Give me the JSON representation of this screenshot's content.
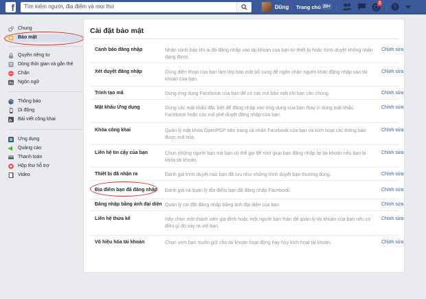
{
  "topbar": {
    "logo": "f",
    "search_placeholder": "Tìm kiếm người, địa điểm và mọi thứ",
    "user_name": "Dũng",
    "home_label": "Trang chủ",
    "home_badge": "20+",
    "notif_count": "3",
    "icons": [
      "search-icon",
      "friend-requests-icon",
      "messages-icon",
      "notifications-icon",
      "help-icon",
      "dropdown-icon"
    ]
  },
  "sidebar": {
    "items": [
      {
        "label": "Chung",
        "icon": "gear-icon",
        "color": "#8d949e"
      },
      {
        "label": "Bảo mật",
        "icon": "shield-icon",
        "color": "#f7b928",
        "active": true
      },
      {
        "label": "Quyền riêng tư",
        "icon": "lock-icon",
        "color": "#8d949e"
      },
      {
        "label": "Dòng thời gian và gắn thẻ",
        "icon": "timeline-icon",
        "color": "#8d949e"
      },
      {
        "label": "Chặn",
        "icon": "block-icon",
        "color": "#fa3e3e"
      },
      {
        "label": "Ngôn ngữ",
        "icon": "language-icon",
        "color": "#4b4f56"
      },
      {
        "label": "Thông báo",
        "icon": "globe-icon",
        "color": "#4b4f56"
      },
      {
        "label": "Di động",
        "icon": "mobile-icon",
        "color": "#4b4f56"
      },
      {
        "label": "Bài viết công khai",
        "icon": "rss-icon",
        "color": "#4b4f56"
      },
      {
        "label": "Ứng dụng",
        "icon": "apps-icon",
        "color": "#3b5998"
      },
      {
        "label": "Quảng cáo",
        "icon": "ads-icon",
        "color": "#42b72a"
      },
      {
        "label": "Thanh toán",
        "icon": "payment-icon",
        "color": "#4b4f56"
      },
      {
        "label": "Hộp thư hỗ trợ",
        "icon": "support-icon",
        "color": "#fa3e3e"
      },
      {
        "label": "Video",
        "icon": "video-icon",
        "color": "#4b4f56"
      }
    ]
  },
  "main": {
    "title": "Cài đặt bảo mật",
    "edit_label": "Chỉnh sửa",
    "rows": [
      {
        "label": "Cảnh báo đăng nhập",
        "desc": "Nhận cảnh báo khi ai đó đăng nhập vào tài khoản của bạn từ thiết bị hoặc trình duyệt không nhận dạng được."
      },
      {
        "label": "Xét duyệt đăng nhập",
        "desc": "Dùng điện thoại của bạn làm lớp bảo mật bổ sung để ngăn chặn người khác đăng nhập vào tài khoản của bạn."
      },
      {
        "label": "Trình tạo mã",
        "desc": "Dùng ứng dụng Facebook của bạn để có các mã bảo mật khi bạn cần chúng."
      },
      {
        "label": "Mật khẩu Ứng dụng",
        "desc": "Dùng các mật khẩu đặc biệt để đăng nhập vào ứng dụng của bạn thay vì dùng mật khẩu Facebook hoặc các mã phê duyệt đăng nhập của bạn."
      },
      {
        "label": "Khóa công khai",
        "desc": "Quản lý mật khóa OpenPGP trên trang cá nhân Facebook của bạn và kích hoạt các thông báo được mã hóa."
      },
      {
        "label": "Liên hệ tin cậy của bạn",
        "desc": "Chọn những người bạn mà bạn có thể gọi để nhờ giúp bạn đăng nhập lại tài khoản nếu bạn bị khóa tài khoản."
      },
      {
        "label": "Thiết bị đã nhận ra",
        "desc": "Đánh giá trình duyệt nào bạn đã lưu như những trình duyệt bạn thường dùng."
      },
      {
        "label": "Địa điểm bạn đã đăng nhập",
        "desc": "Đánh giá và quản lý địa điểm bạn đã đăng nhập Facebook."
      },
      {
        "label": "Đăng nhập bằng ảnh đại diện",
        "desc": "Quản lý cài đặt đăng nhập bằng ảnh đại diện của bạn"
      },
      {
        "label": "Liên hệ thừa kế",
        "desc": "Hãy chọn một thành viên gia đình hoặc một người bạn thân để quản lý tài khoản của bạn nếu có điều gì đó xảy ra với bạn."
      },
      {
        "label": "Vô hiệu hóa tài khoản",
        "desc": "Chọn xem bạn muốn giữ cho tài khoản hoạt động hay hủy kích hoạt tài khoản."
      }
    ]
  },
  "annotations": {
    "circle_color": "#dd2222"
  }
}
